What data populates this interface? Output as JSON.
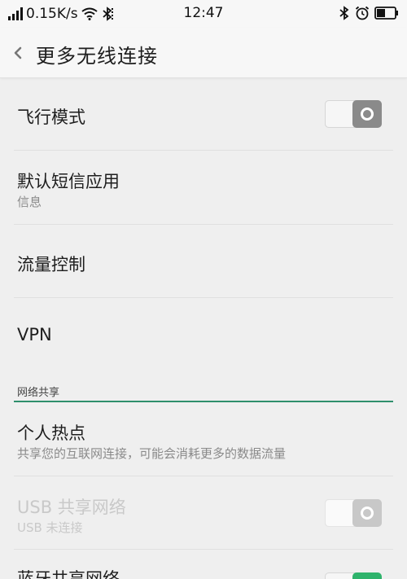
{
  "status_bar": {
    "speed": "0.15K/s",
    "time": "12:47"
  },
  "header": {
    "title": "更多无线连接"
  },
  "items": {
    "airplane": {
      "title": "飞行模式",
      "toggle_on": false
    },
    "sms": {
      "title": "默认短信应用",
      "subtitle": "信息"
    },
    "traffic": {
      "title": "流量控制"
    },
    "vpn": {
      "title": "VPN"
    },
    "section_network_sharing": "网络共享",
    "hotspot": {
      "title": "个人热点",
      "subtitle": "共享您的互联网连接，可能会消耗更多的数据流量"
    },
    "usb": {
      "title": "USB 共享网络",
      "subtitle": "USB 未连接",
      "enabled": false,
      "toggle_on": false
    },
    "bluetooth": {
      "title": "蓝牙共享网络",
      "toggle_on": true
    }
  },
  "colors": {
    "accent": "#2f8f6c",
    "toggle_on": "#2fb36c"
  }
}
